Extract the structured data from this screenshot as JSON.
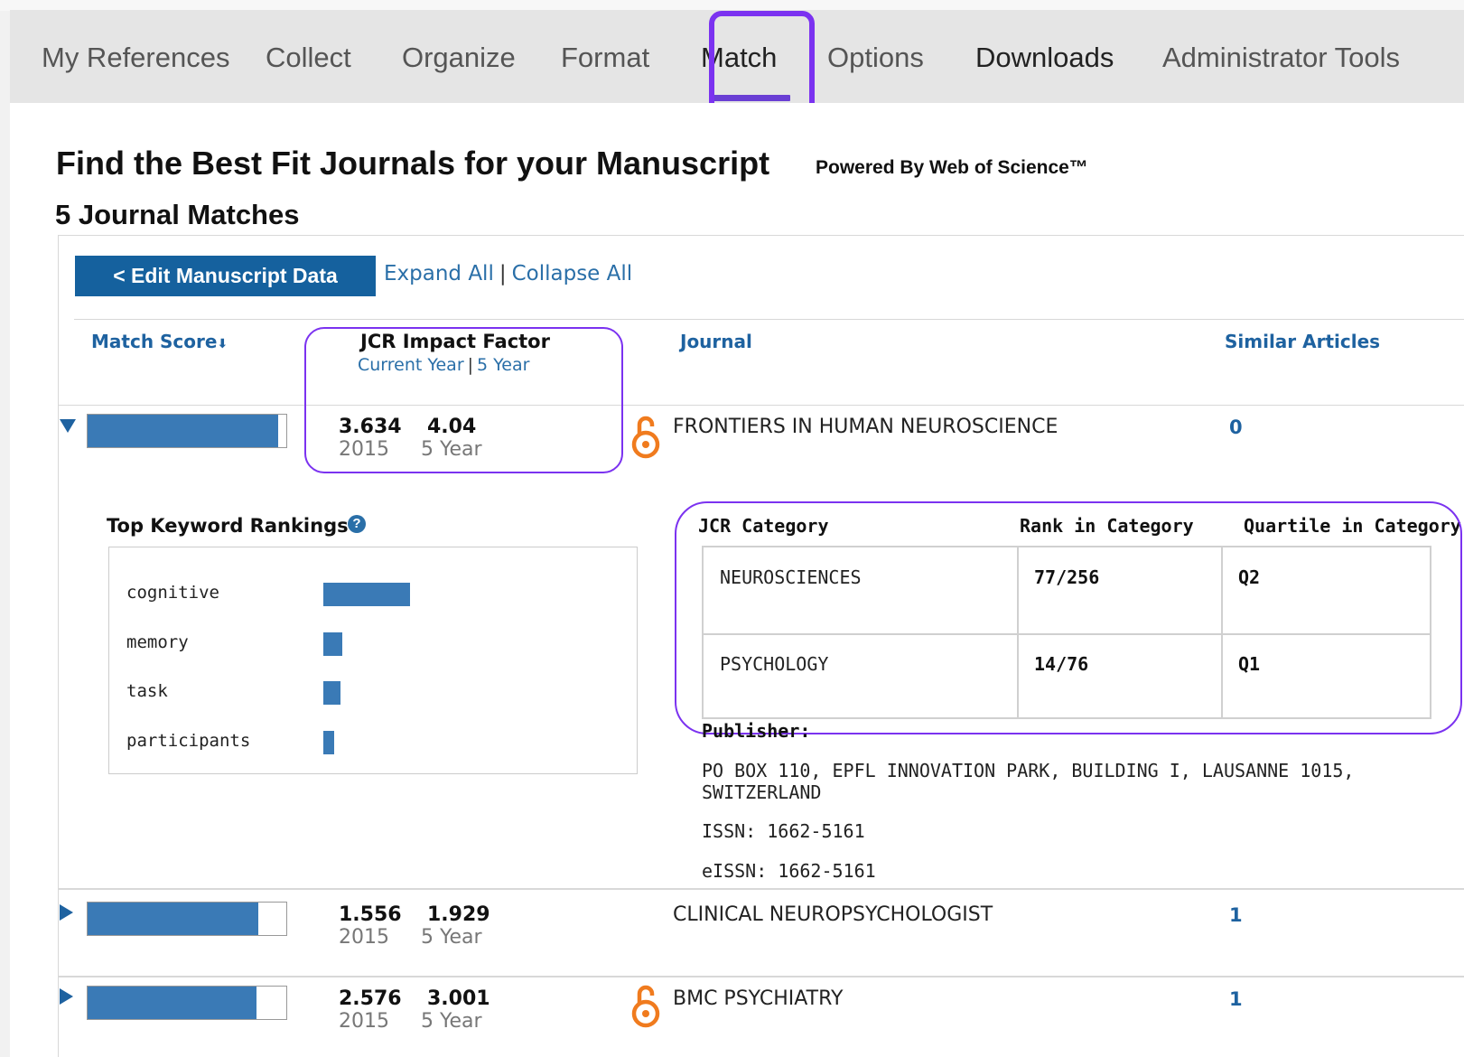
{
  "nav": {
    "items": [
      "My References",
      "Collect",
      "Organize",
      "Format",
      "Match",
      "Options",
      "Downloads",
      "Administrator Tools"
    ],
    "active": "Match"
  },
  "page": {
    "title": "Find the Best Fit Journals for your Manuscript",
    "powered_by": "Powered By Web of Science™",
    "matches": "5 Journal Matches"
  },
  "toolbar": {
    "edit_label": "< Edit Manuscript Data",
    "expand_all": "Expand All",
    "separator": "|",
    "collapse_all": "Collapse All"
  },
  "columns": {
    "match_score": "Match Score",
    "sort_arrow": "⬇",
    "jcr_impact_factor": "JCR Impact Factor",
    "current_year": "Current Year",
    "five_year": "5 Year",
    "journal": "Journal",
    "similar_articles": "Similar Articles"
  },
  "rows": [
    {
      "expanded": true,
      "score_fraction": 0.96,
      "impact_current": "3.634",
      "impact_current_label": "2015",
      "impact_5yr": "4.04",
      "impact_5yr_label": "5 Year",
      "open_access": true,
      "journal": "FRONTIERS IN HUMAN NEUROSCIENCE",
      "similar": "0"
    },
    {
      "expanded": false,
      "score_fraction": 0.86,
      "impact_current": "1.556",
      "impact_current_label": "2015",
      "impact_5yr": "1.929",
      "impact_5yr_label": "5 Year",
      "open_access": false,
      "journal": "CLINICAL NEUROPSYCHOLOGIST",
      "similar": "1"
    },
    {
      "expanded": false,
      "score_fraction": 0.85,
      "impact_current": "2.576",
      "impact_current_label": "2015",
      "impact_5yr": "3.001",
      "impact_5yr_label": "5 Year",
      "open_access": true,
      "journal": "BMC PSYCHIATRY",
      "similar": "1"
    }
  ],
  "details": {
    "keyword_title": "Top Keyword Rankings",
    "help": "?",
    "keywords": [
      {
        "label": "cognitive",
        "fraction": 1.0
      },
      {
        "label": "memory",
        "fraction": 0.22
      },
      {
        "label": "task",
        "fraction": 0.2
      },
      {
        "label": "participants",
        "fraction": 0.13
      }
    ],
    "category_headers": {
      "category": "JCR Category",
      "rank": "Rank in Category",
      "quartile": "Quartile in Category"
    },
    "categories": [
      {
        "name": "NEUROSCIENCES",
        "rank": "77/256",
        "quartile": "Q2"
      },
      {
        "name": "PSYCHOLOGY",
        "rank": "14/76",
        "quartile": "Q1"
      }
    ],
    "publisher_label": "Publisher:",
    "publisher_line1": "PO BOX 110, EPFL INNOVATION PARK, BUILDING I, LAUSANNE 1015,",
    "publisher_line2": "SWITZERLAND",
    "issn": "ISSN: 1662-5161",
    "eissn": "eISSN: 1662-5161"
  },
  "colors": {
    "accent": "#15619e",
    "bar": "#3a7ab6",
    "highlight": "#7b32f0",
    "open_access": "#f07b1e"
  }
}
